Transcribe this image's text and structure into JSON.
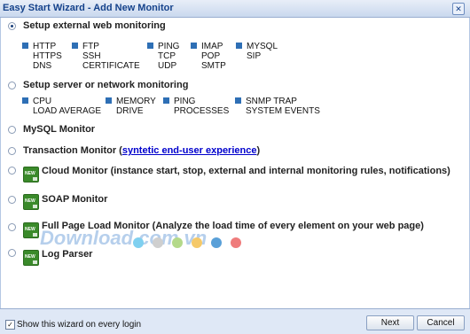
{
  "window": {
    "title": "Easy Start Wizard - Add New Monitor",
    "close_glyph": "✕"
  },
  "options": {
    "external": {
      "label": "Setup external web monitoring",
      "services": [
        {
          "l1": "HTTP",
          "l2": "HTTPS",
          "l3": "DNS"
        },
        {
          "l1": "FTP",
          "l2": "SSH",
          "l3": "CERTIFICATE"
        },
        {
          "l1": "PING",
          "l2": "TCP",
          "l3": "UDP"
        },
        {
          "l1": "IMAP",
          "l2": "POP",
          "l3": "SMTP"
        },
        {
          "l1": "MYSQL",
          "l2": "SIP",
          "l3": ""
        }
      ]
    },
    "server": {
      "label": "Setup server or network monitoring",
      "services": [
        {
          "l1": "CPU",
          "l2": "LOAD AVERAGE"
        },
        {
          "l1": "MEMORY",
          "l2": "DRIVE"
        },
        {
          "l1": "PING",
          "l2": "PROCESSES"
        },
        {
          "l1": "SNMP TRAP",
          "l2": "SYSTEM EVENTS"
        }
      ]
    },
    "mysql": {
      "label": "MySQL Monitor"
    },
    "transaction": {
      "label_pre": "Transaction Monitor (",
      "link": "syntetic end-user experience",
      "label_post": ")"
    },
    "cloud": {
      "label": "Cloud Monitor (instance start, stop, external and internal monitoring rules, notifications)"
    },
    "soap": {
      "label": "SOAP Monitor"
    },
    "fullpage": {
      "label": "Full Page Load Monitor (Analyze the load time of every element on your web page)"
    },
    "logparser": {
      "label": "Log Parser"
    }
  },
  "badge_text": "NEW",
  "watermark": "Download.com.vn",
  "footer": {
    "checkbox_checked": true,
    "checkbox_glyph": "✓",
    "checkbox_label": "Show this wizard on every login",
    "next_label": "Next",
    "cancel_label": "Cancel"
  },
  "colors": {
    "accent": "#2e6fb5",
    "new_badge": "#3a8a2a",
    "dots": [
      "#7fd0f0",
      "#cfcfcf",
      "#b4d98a",
      "#f5c96a",
      "#5aa0d8",
      "#ef7c7c"
    ]
  }
}
